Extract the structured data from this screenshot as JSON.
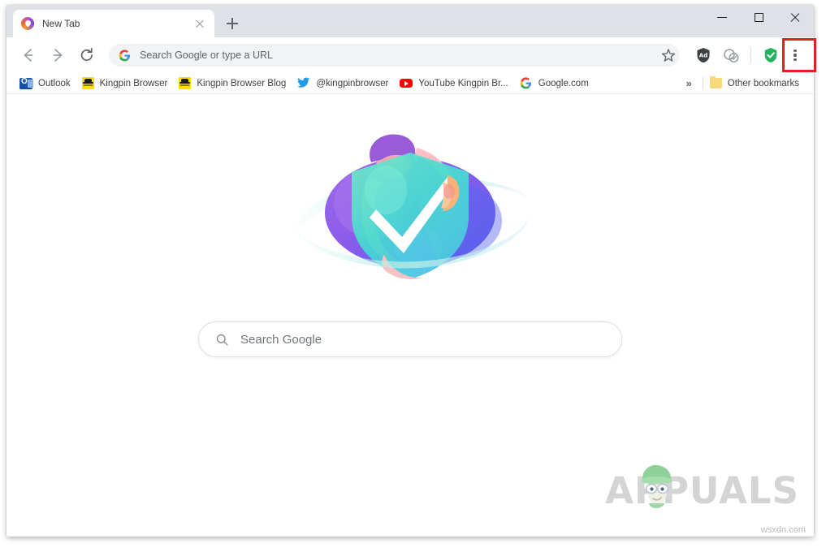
{
  "window": {
    "controls": {
      "minimize": "minimize",
      "maximize": "maximize",
      "close": "close"
    }
  },
  "tabstrip": {
    "tabs": [
      {
        "title": "New Tab",
        "favicon": "kingpin-favicon",
        "close_label": "Close tab"
      }
    ],
    "new_tab_label": "New tab"
  },
  "toolbar": {
    "back_label": "Back",
    "forward_label": "Forward",
    "reload_label": "Reload",
    "omnibox": {
      "icon": "google-g-icon",
      "placeholder": "Search Google or type a URL",
      "value": ""
    },
    "bookmark_star_label": "Bookmark this page",
    "extensions": [
      {
        "name": "adblock-extension-icon",
        "label": "AdBlock"
      },
      {
        "name": "privacy-cookie-extension-icon",
        "label": "Cookie blocker"
      }
    ],
    "security_shield_label": "Protection active",
    "menu_label": "Customize and control",
    "menu_dots": 3,
    "highlight_color": "#e02121"
  },
  "bookmarks": {
    "items": [
      {
        "label": "Outlook",
        "icon": "outlook-icon"
      },
      {
        "label": "Kingpin Browser",
        "icon": "kingpin-icon"
      },
      {
        "label": "Kingpin Browser Blog",
        "icon": "kingpin-icon"
      },
      {
        "label": "@kingpinbrowser",
        "icon": "twitter-icon"
      },
      {
        "label": "YouTube Kingpin Br...",
        "icon": "youtube-icon"
      },
      {
        "label": "Google.com",
        "icon": "google-g-icon"
      }
    ],
    "overflow_label": "»",
    "other_bookmarks": {
      "label": "Other bookmarks",
      "icon": "folder-icon"
    }
  },
  "page": {
    "hero_illustration": "person-holding-shield-with-checkmark",
    "search": {
      "placeholder": "Search Google",
      "value": "",
      "icon": "search-icon"
    }
  },
  "watermark": {
    "brand": "APPUALS",
    "mascot": "appuals-mascot-icon",
    "site_credit": "wsxdn.com"
  },
  "colors": {
    "tabstrip_bg": "#dee1e6",
    "omnibox_bg": "#f1f3f4",
    "highlight_red": "#e02121",
    "shield_green": "#21b45e",
    "watermark_gray": "#d4d4d4"
  }
}
